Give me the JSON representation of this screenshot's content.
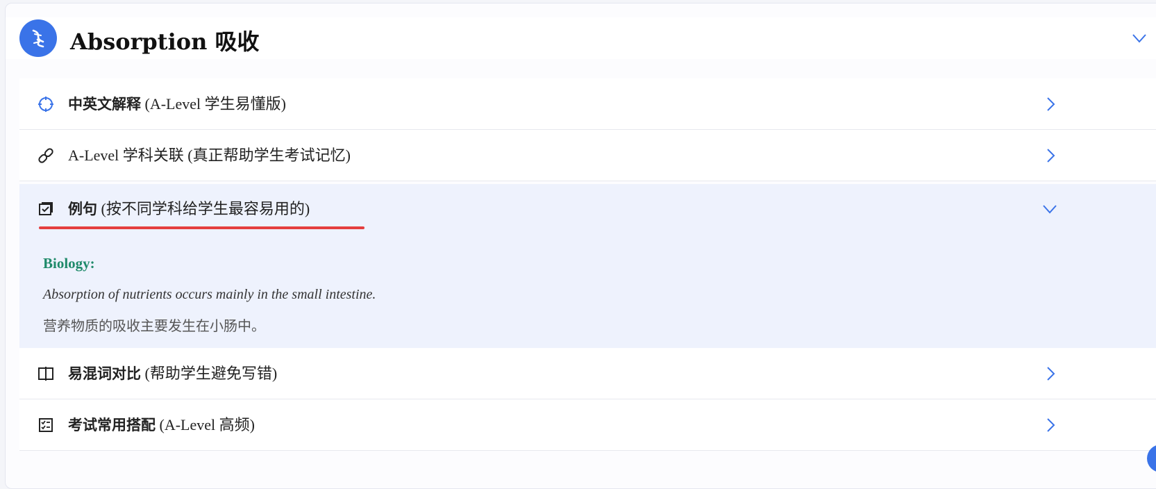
{
  "header": {
    "title": "Absorption 吸收",
    "logo_icon": "dna-icon",
    "collapse_icon": "chevron-down-icon"
  },
  "sections": [
    {
      "icon": "target-icon",
      "main": "中英文解释",
      "sub": " (A-Level 学生易懂版)",
      "chevron": "chevron-right-icon"
    },
    {
      "icon": "link-icon",
      "main": "",
      "sub": "A-Level 学科关联 (真正帮助学生考试记忆)",
      "chevron": "chevron-right-icon"
    },
    {
      "icon": "check-box-icon",
      "main": "例句",
      "sub": " (按不同学科给学生最容易用的)",
      "chevron": "chevron-down-icon"
    },
    {
      "icon": "book-split-icon",
      "main": "易混词对比",
      "sub": " (帮助学生避免写错)",
      "chevron": "chevron-right-icon"
    },
    {
      "icon": "checklist-icon",
      "main": "考试常用搭配",
      "sub": " (A-Level 高频)",
      "chevron": "chevron-right-icon"
    }
  ],
  "example": {
    "subject": "Biology:",
    "sentence_en": "Absorption of nutrients occurs mainly in the small intestine.",
    "sentence_zh": "营养物质的吸收主要发生在小肠中。"
  },
  "colors": {
    "accent": "#3a73e8",
    "expanded_bg": "#eef2fd",
    "highlight_underline": "#e43e3e",
    "subject_green": "#1f8a6a"
  }
}
